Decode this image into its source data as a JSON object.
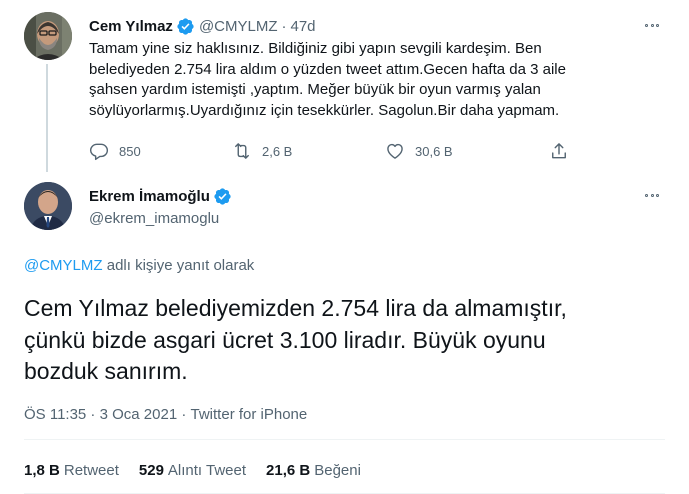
{
  "parent": {
    "name": "Cem Yılmaz",
    "handle": "@CMYLMZ",
    "separator": "·",
    "time": "47d",
    "text": "Tamam yine siz haklısınız. Bildiğiniz gibi yapın sevgili kardeşim. Ben\nbelediyeden 2.754 lira aldım o yüzden tweet attım.Gecen hafta da 3  aile\nşahsen yardım istemişti ,yaptım. Meğer büyük bir oyun varmış yalan\nsöylüyorlarmış.Uyardığınız için tesekkürler. Sagolun.Bir daha yapmam.",
    "replies": "850",
    "retweets": "2,6 B",
    "likes": "30,6 B",
    "icons": [
      "verified-badge-icon",
      "more-icon",
      "reply-icon",
      "retweet-icon",
      "like-icon",
      "share-icon"
    ]
  },
  "main": {
    "name": "Ekrem İmamoğlu",
    "handle": "@ekrem_imamoglu",
    "reply_to_handle": "@CMYLMZ",
    "reply_to_suffix": " adlı kişiye yanıt olarak",
    "text": "Cem Yılmaz belediyemizden 2.754 lira da almamıştır,\nçünkü bizde asgari ücret 3.100 liradır. Büyük oyunu\nbozduk sanırım.",
    "time": "ÖS 11:35",
    "date": "3 Oca 2021",
    "source": "Twitter for iPhone",
    "meta_separator": " · ",
    "stats": {
      "retweets_count": "1,8 B",
      "retweets_label": "Retweet",
      "quotes_count": "529",
      "quotes_label": "Alıntı Tweet",
      "likes_count": "21,6 B",
      "likes_label": "Beğeni"
    }
  },
  "colors": {
    "accent": "#1d9bf0",
    "text": "#0f1419",
    "muted": "#536471",
    "line": "#cfd9de"
  }
}
